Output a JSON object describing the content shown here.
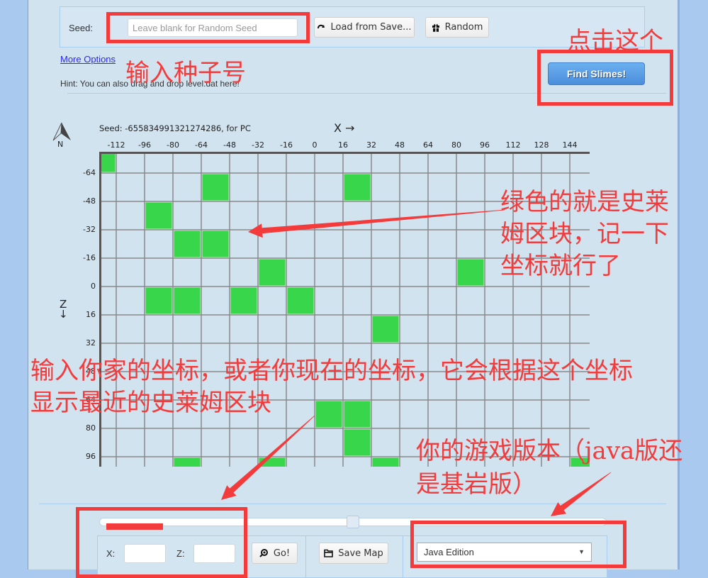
{
  "seed_panel": {
    "label": "Seed:",
    "input_value": "",
    "input_placeholder": "Leave blank for Random Seed",
    "load_button": "Load from Save...",
    "random_button": "Random"
  },
  "more_options": "More Options",
  "hint": "Hint: You can also drag and drop level.dat here!",
  "find_button": "Find Slimes!",
  "map": {
    "seed_info": "Seed: -655834991321274286, for PC",
    "x_axis_label": "X →",
    "z_axis_label": "Z",
    "z_axis_arrow": "↓",
    "compass_label": "N",
    "chunk_size": 16,
    "x_ticks": [
      -112,
      -96,
      -80,
      -64,
      -48,
      -32,
      -16,
      0,
      16,
      32,
      48,
      64,
      80,
      96,
      112,
      128,
      144
    ],
    "z_ticks": [
      -64,
      -48,
      -32,
      -16,
      0,
      16,
      32,
      48,
      64,
      80,
      96
    ],
    "slime_chunks": [
      {
        "x": -128,
        "z": -80
      },
      {
        "x": -64,
        "z": -64
      },
      {
        "x": 16,
        "z": -64
      },
      {
        "x": -96,
        "z": -48
      },
      {
        "x": -80,
        "z": -32
      },
      {
        "x": -64,
        "z": -32
      },
      {
        "x": -32,
        "z": -16
      },
      {
        "x": 80,
        "z": -16
      },
      {
        "x": -96,
        "z": 0
      },
      {
        "x": -80,
        "z": 0
      },
      {
        "x": -48,
        "z": 0
      },
      {
        "x": -16,
        "z": 0
      },
      {
        "x": 32,
        "z": 16
      },
      {
        "x": 0,
        "z": 64
      },
      {
        "x": 16,
        "z": 64
      },
      {
        "x": 16,
        "z": 80
      },
      {
        "x": -80,
        "z": 96
      },
      {
        "x": -32,
        "z": 96
      },
      {
        "x": 32,
        "z": 96
      },
      {
        "x": 144,
        "z": 96
      }
    ]
  },
  "zoom_slider": {
    "value": 0.5
  },
  "coords": {
    "x_label": "X:",
    "z_label": "Z:",
    "x_value": "",
    "z_value": "",
    "go_button": "Go!",
    "save_button": "Save Map"
  },
  "edition_select": {
    "selected": "Java Edition"
  },
  "annotations": {
    "click_this": "点击这个",
    "enter_seed": "输入种子号",
    "green_is_slime": [
      "绿色的就是史莱",
      "姆区块，记一下",
      "坐标就行了"
    ],
    "enter_coords": [
      "输入你家的坐标，或者你现在的坐标，它会根据这个坐标",
      "显示最近的史莱姆区块"
    ],
    "game_version": [
      "你的游戏版本（java版还",
      "是基岩版）"
    ]
  },
  "colors": {
    "slime_chunk": "#37d64b",
    "grid_line": "#8a8a8a",
    "axis_line": "#555555",
    "annotation_red": "#f43b3b",
    "primary_button": "#4a8ddb",
    "panel_bg": "#d2e3f0",
    "page_bg": "#a9c9ee"
  }
}
